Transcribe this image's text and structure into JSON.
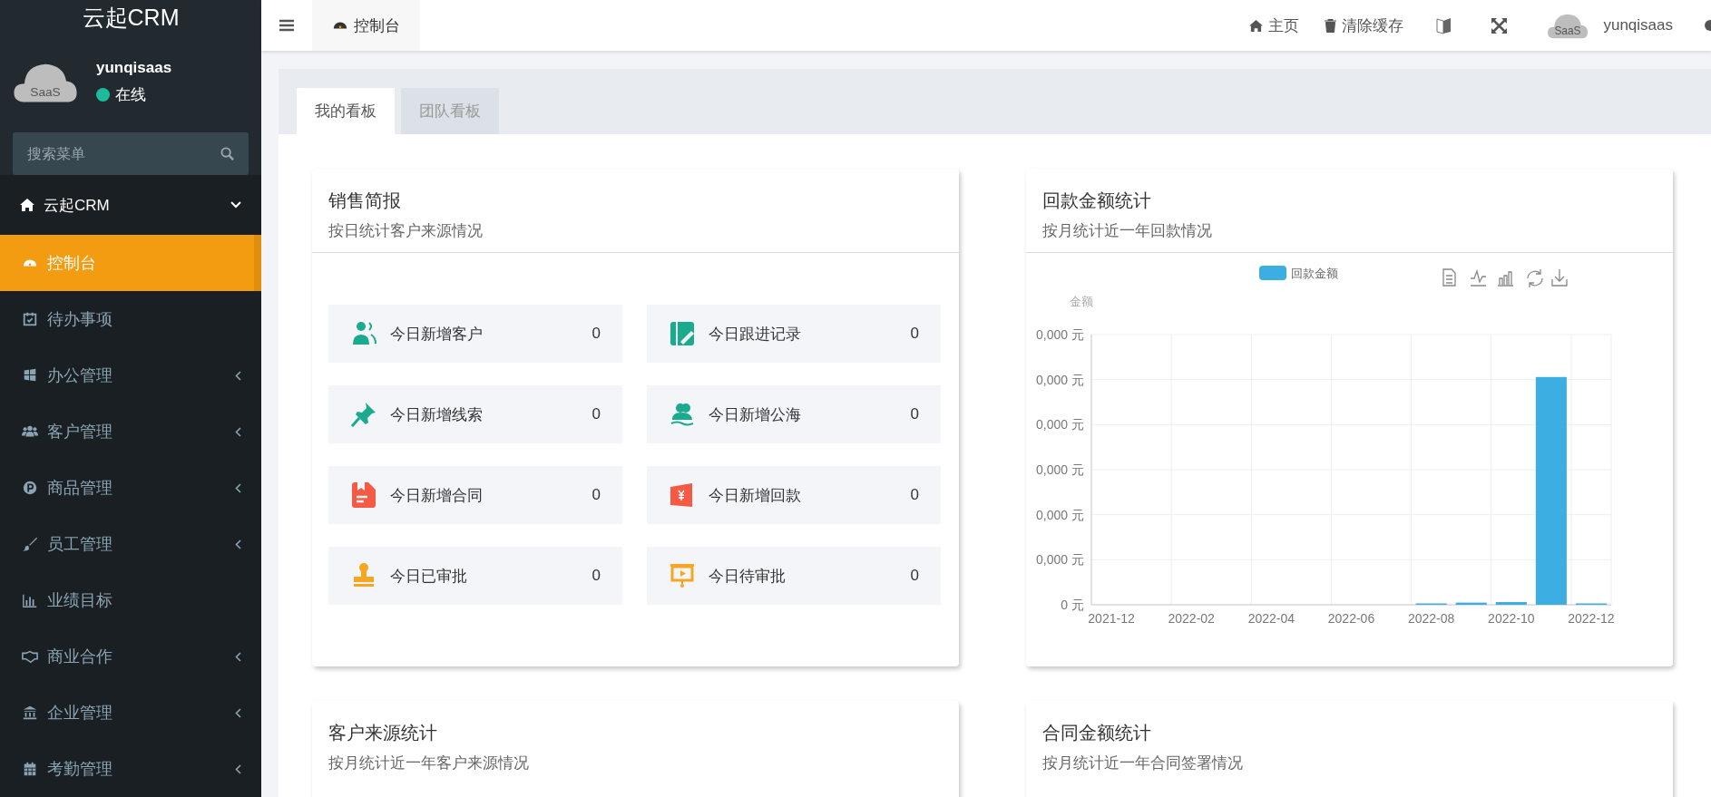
{
  "sidebar": {
    "brand": "云起CRM",
    "user": {
      "name": "yunqisaas",
      "avatar_text": "SaaS",
      "status": "在线"
    },
    "search": {
      "placeholder": "搜索菜单"
    },
    "group": {
      "label": "云起CRM",
      "expanded": true
    },
    "items": [
      {
        "label": "控制台",
        "selected": true,
        "has_children": false
      },
      {
        "label": "待办事项",
        "selected": false,
        "has_children": false
      },
      {
        "label": "办公管理",
        "selected": false,
        "has_children": true
      },
      {
        "label": "客户管理",
        "selected": false,
        "has_children": true
      },
      {
        "label": "商品管理",
        "selected": false,
        "has_children": true
      },
      {
        "label": "员工管理",
        "selected": false,
        "has_children": true
      },
      {
        "label": "业绩目标",
        "selected": false,
        "has_children": false
      },
      {
        "label": "商业合作",
        "selected": false,
        "has_children": true
      },
      {
        "label": "企业管理",
        "selected": false,
        "has_children": true
      },
      {
        "label": "考勤管理",
        "selected": false,
        "has_children": true
      }
    ]
  },
  "topbar": {
    "tab": "控制台",
    "home": "主页",
    "clear_cache": "清除缓存",
    "user": "yunqisaas",
    "avatar_text": "SaaS"
  },
  "board_tabs": [
    {
      "label": "我的看板",
      "selected": true
    },
    {
      "label": "团队看板",
      "selected": false
    }
  ],
  "sales_card": {
    "title": "销售简报",
    "subtitle": "按日统计客户来源情况",
    "stats": [
      {
        "label": "今日新增客户",
        "value": "0",
        "color": "#1aaa8e"
      },
      {
        "label": "今日跟进记录",
        "value": "0",
        "color": "#1aaa8e"
      },
      {
        "label": "今日新增线索",
        "value": "0",
        "color": "#1aaa8e"
      },
      {
        "label": "今日新增公海",
        "value": "0",
        "color": "#1aaa8e"
      },
      {
        "label": "今日新增合同",
        "value": "0",
        "color": "#f55a45"
      },
      {
        "label": "今日新增回款",
        "value": "0",
        "color": "#f55a45"
      },
      {
        "label": "今日已审批",
        "value": "0",
        "color": "#f5a623"
      },
      {
        "label": "今日待审批",
        "value": "0",
        "color": "#f5a623"
      }
    ]
  },
  "payment_card": {
    "title": "回款金额统计",
    "subtitle": "按月统计近一年回款情况",
    "legend": "回款金额",
    "y_name": "金额",
    "y_labels": [
      "0,000 元",
      "0,000 元",
      "0,000 元",
      "0,000 元",
      "0,000 元",
      "0,000 元",
      "0 元"
    ],
    "x_labels": [
      "2021-12",
      "2022-02",
      "2022-04",
      "2022-06",
      "2022-08",
      "2022-10",
      "2022-12"
    ]
  },
  "bottom_cards": [
    {
      "title": "客户来源统计",
      "subtitle": "按月统计近一年客户来源情况"
    },
    {
      "title": "合同金额统计",
      "subtitle": "按月统计近一年合同签署情况"
    }
  ]
}
